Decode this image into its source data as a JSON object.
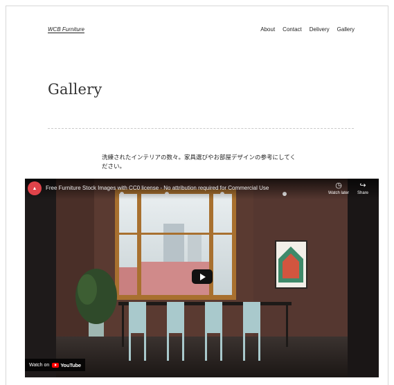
{
  "header": {
    "site_title": "WCB Furniture",
    "nav": [
      "About",
      "Contact",
      "Delivery",
      "Gallery"
    ]
  },
  "page": {
    "title": "Gallery",
    "intro": "洗練されたインテリアの数々。家具選びやお部屋デザインの参考にしてください。"
  },
  "video": {
    "title": "Free Furniture Stock Images with CC0 license - No attribution required for Commercial Use",
    "watch_later": "Watch later",
    "share": "Share",
    "watch_on": "Watch on",
    "youtube": "YouTube",
    "channel_icon": "channel-logo-icon",
    "accent_color": "#e0434a"
  }
}
